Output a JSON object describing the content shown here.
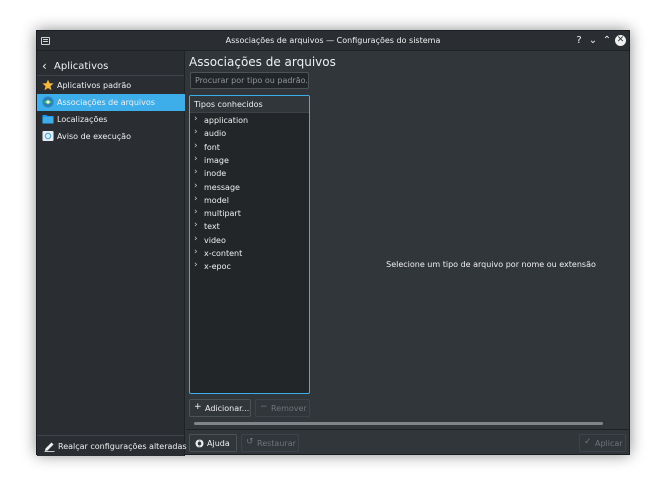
{
  "window": {
    "title": "Associações de arquivos — Configurações do sistema",
    "help_glyph": "?",
    "minimize_glyph": "⌄",
    "maximize_glyph": "⌃",
    "close_glyph": "✕"
  },
  "sidebar": {
    "back_glyph": "‹",
    "header": "Aplicativos",
    "items": [
      {
        "label": "Aplicativos padrão",
        "icon": "star-icon",
        "active": false
      },
      {
        "label": "Associações de arquivos",
        "icon": "file-associations-icon",
        "active": true
      },
      {
        "label": "Localizações",
        "icon": "folder-icon",
        "active": false
      },
      {
        "label": "Aviso de execução",
        "icon": "launch-feedback-icon",
        "active": false
      }
    ],
    "footer_label": "Realçar configurações alteradas",
    "footer_icon": "pencil-icon"
  },
  "main": {
    "title": "Associações de arquivos",
    "search_placeholder": "Procurar por tipo ou padrão...",
    "tree_header": "Tipos conhecidos",
    "tree_items": [
      "application",
      "audio",
      "font",
      "image",
      "inode",
      "message",
      "model",
      "multipart",
      "text",
      "video",
      "x-content",
      "x-epoc"
    ],
    "chevron": "›",
    "add_label": "Adicionar...",
    "add_icon": "+",
    "remove_label": "Remover",
    "remove_icon": "−",
    "hint": "Selecione um tipo de arquivo por nome ou extensão"
  },
  "footer": {
    "help_label": "Ajuda",
    "reset_label": "Restaurar",
    "reset_icon": "↺",
    "apply_label": "Aplicar",
    "apply_icon": "✓"
  },
  "colors": {
    "window_bg": "#31363b",
    "sidebar_bg": "#2a2e32",
    "accent": "#3daee9",
    "text": "#eff0f1",
    "disabled_text": "#6e7479"
  }
}
